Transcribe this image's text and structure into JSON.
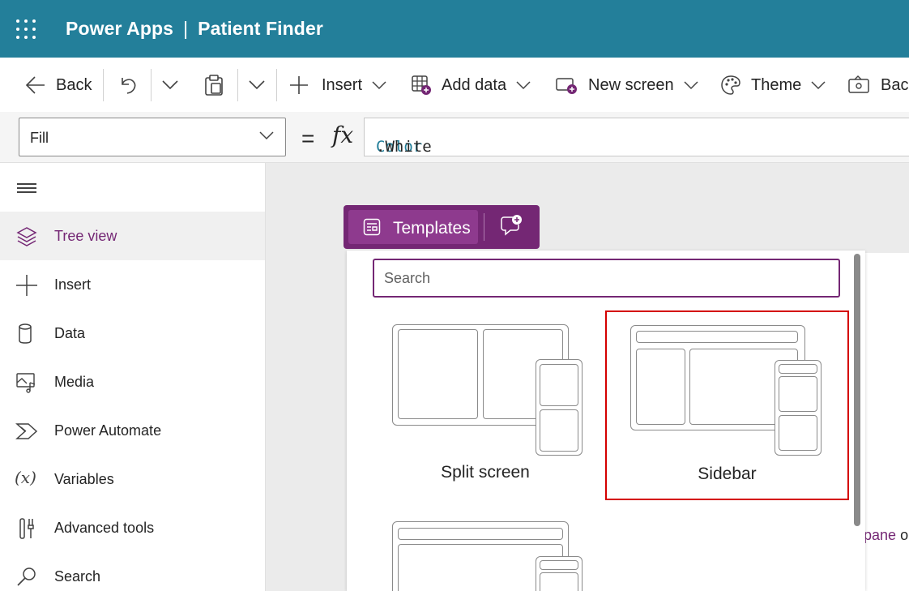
{
  "titlebar": {
    "app_name": "Power Apps",
    "separator": "|",
    "app_title": "Patient Finder",
    "background": "#237f9a"
  },
  "commandbar": {
    "back_label": "Back",
    "insert_label": "Insert",
    "add_data_label": "Add data",
    "new_screen_label": "New screen",
    "theme_label": "Theme",
    "background_label": "Bac",
    "icons": [
      "back-arrow-icon",
      "undo-icon",
      "chevron-down-icon",
      "paste-icon",
      "plus-icon",
      "table-add-icon",
      "screen-add-icon",
      "palette-icon",
      "background-icon"
    ]
  },
  "formulabar": {
    "property_value": "Fill",
    "equals": "=",
    "fx": "fx",
    "formula_keyword": "Color",
    "formula_rest": ".White"
  },
  "leftnav": {
    "items": [
      {
        "label": "Tree view",
        "icon": "layers-icon",
        "selected": true
      },
      {
        "label": "Insert",
        "icon": "plus-icon",
        "selected": false
      },
      {
        "label": "Data",
        "icon": "database-icon",
        "selected": false
      },
      {
        "label": "Media",
        "icon": "media-icon",
        "selected": false
      },
      {
        "label": "Power Automate",
        "icon": "power-automate-icon",
        "selected": false
      },
      {
        "label": "Variables",
        "icon": "variables-icon",
        "selected": false
      },
      {
        "label": "Advanced tools",
        "icon": "tools-icon",
        "selected": false
      },
      {
        "label": "Search",
        "icon": "search-icon",
        "selected": false
      }
    ]
  },
  "templates_toolbar": {
    "templates_label": "Templates",
    "accent": "#742774"
  },
  "templates_panel": {
    "search_placeholder": "Search",
    "items": [
      {
        "caption": "Split screen",
        "highlighted": false
      },
      {
        "caption": "Sidebar",
        "highlighted": true
      },
      {
        "caption": "",
        "highlighted": false
      }
    ]
  },
  "canvas": {
    "pane_link_text": "pane",
    "pane_trailing_text": "or"
  }
}
